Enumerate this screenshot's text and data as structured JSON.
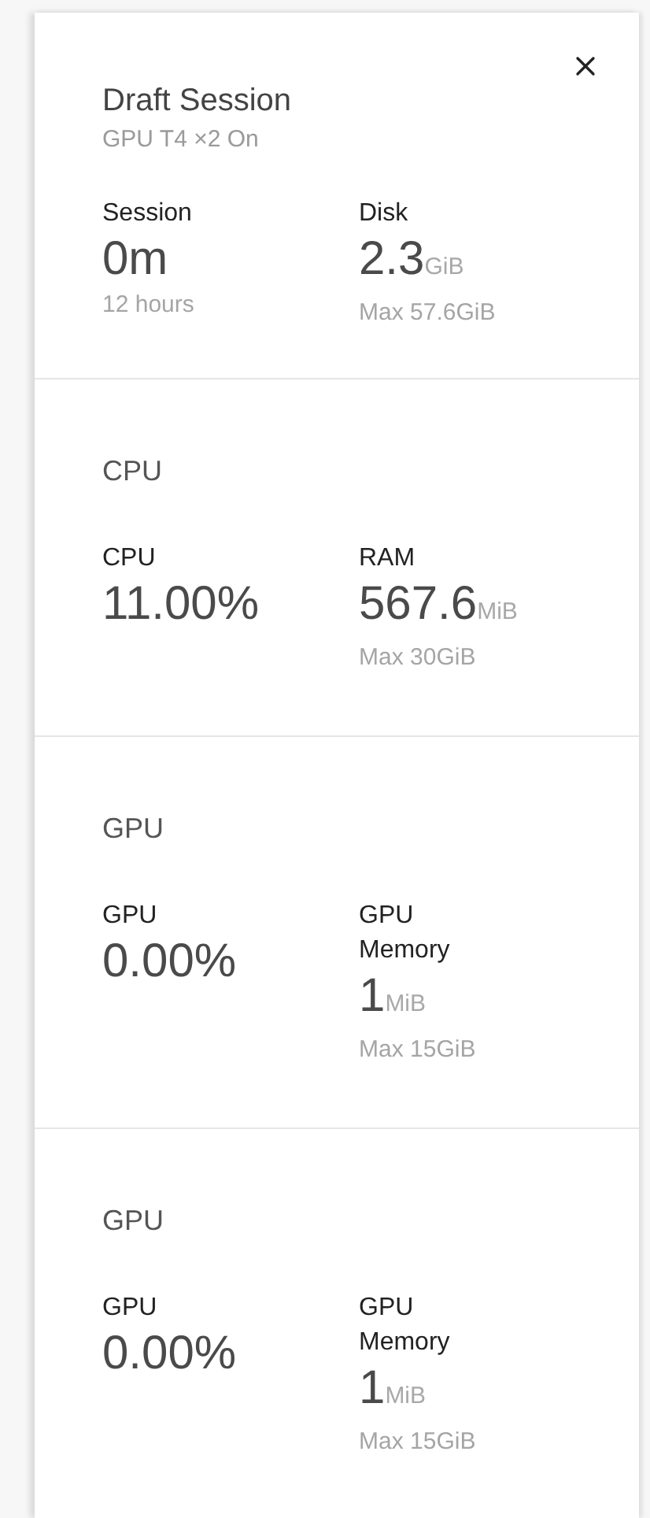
{
  "header": {
    "title": "Draft Session",
    "subtitle": "GPU T4 ×2 On"
  },
  "summary": [
    {
      "label": "Session",
      "value": "0m",
      "note": "12 hours"
    },
    {
      "label": "Disk",
      "value": "2.3",
      "unit": "GiB",
      "note": "Max 57.6GiB"
    }
  ],
  "sections": [
    {
      "title": "CPU",
      "metrics": [
        {
          "label": "CPU",
          "value": "11.00%"
        },
        {
          "label": "RAM",
          "value": "567.6",
          "unit": "MiB",
          "note": "Max 30GiB"
        }
      ]
    },
    {
      "title": "GPU",
      "metrics": [
        {
          "label": "GPU",
          "value": "0.00%"
        },
        {
          "label": "GPU Memory",
          "value": "1",
          "unit": "MiB",
          "note": "Max 15GiB"
        }
      ]
    },
    {
      "title": "GPU",
      "metrics": [
        {
          "label": "GPU",
          "value": "0.00%"
        },
        {
          "label": "GPU Memory",
          "value": "1",
          "unit": "MiB",
          "note": "Max 15GiB"
        }
      ]
    }
  ]
}
